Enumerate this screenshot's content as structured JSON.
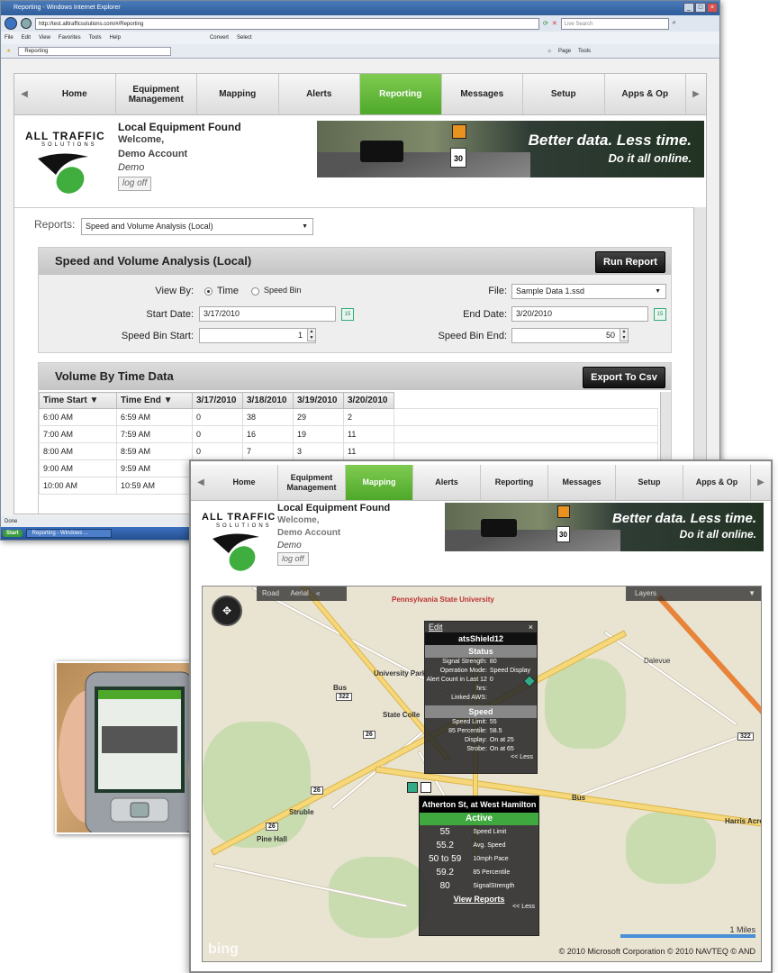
{
  "ie": {
    "title": "Reporting - Windows Internet Explorer",
    "url": "http://test.alltrafficsolutions.com/#/Reporting",
    "search_placeholder": "Live Search",
    "menu": [
      "File",
      "Edit",
      "View",
      "Favorites",
      "Tools",
      "Help"
    ],
    "convert": "Convert",
    "select": "Select",
    "fav_tab": "Reporting",
    "right_tools": [
      "Page",
      "Tools"
    ],
    "status": "Done",
    "start": "Start",
    "task": "Reporting - Windows ..."
  },
  "app": {
    "nav": [
      "Home",
      "Equipment Management",
      "Mapping",
      "Alerts",
      "Reporting",
      "Messages",
      "Setup",
      "Apps & Op"
    ],
    "nav_active_reporting": "Reporting",
    "nav_active_mapping": "Mapping",
    "brand": "ALL TRAFFIC",
    "brand_sub": "SOLUTIONS",
    "header_title": "Local Equipment Found",
    "welcome": "Welcome,",
    "account": "Demo Account",
    "user": "Demo",
    "logoff": "log off",
    "banner_tag1": "Better data. Less time.",
    "banner_tag2": "Do it all online.",
    "speed_sign": "30"
  },
  "reporting": {
    "reports_label": "Reports:",
    "report_select": "Speed and Volume Analysis (Local)",
    "panel_title": "Speed and Volume Analysis (Local)",
    "run_report": "Run Report",
    "view_by_label": "View By:",
    "view_time": "Time",
    "view_speed_bin": "Speed Bin",
    "file_label": "File:",
    "file_value": "Sample Data 1.ssd",
    "start_date_label": "Start Date:",
    "start_date": "3/17/2010",
    "end_date_label": "End Date:",
    "end_date": "3/20/2010",
    "speed_bin_start_label": "Speed Bin Start:",
    "speed_bin_start": "1",
    "speed_bin_end_label": "Speed Bin End:",
    "speed_bin_end": "50",
    "cal_icon_text": "15",
    "volume_title": "Volume By Time Data",
    "export_csv": "Export To Csv",
    "columns": [
      "Time Start",
      "Time End",
      "3/17/2010",
      "3/18/2010",
      "3/19/2010",
      "3/20/2010"
    ],
    "rows": [
      [
        "6:00 AM",
        "6:59 AM",
        "0",
        "38",
        "29",
        "2"
      ],
      [
        "7:00 AM",
        "7:59 AM",
        "0",
        "16",
        "19",
        "11"
      ],
      [
        "8:00 AM",
        "8:59 AM",
        "0",
        "7",
        "3",
        "11"
      ],
      [
        "9:00 AM",
        "9:59 AM",
        "",
        "",
        "",
        ""
      ],
      [
        "10:00 AM",
        "10:59 AM",
        "",
        "",
        "",
        ""
      ]
    ]
  },
  "map": {
    "toolbar_road": "Road",
    "toolbar_aerial": "Aerial",
    "layers": "Layers",
    "labels": {
      "psu": "Pennsylvania State University",
      "university_park": "University Park",
      "state_college": "State Colle",
      "strubble": "Struble",
      "pine_hall": "Pine Hall",
      "dalevue": "Dalevue",
      "harris_acre": "Harris Acre",
      "bus": "Bus",
      "scale": "1 Miles",
      "copyright": "© 2010 Microsoft Corporation   © 2010 NAVTEQ   © AND",
      "bing": "bing"
    },
    "shields": [
      "322",
      "26",
      "26",
      "26",
      "322",
      "26",
      "322"
    ],
    "popup1": {
      "edit": "Edit",
      "close": "×",
      "title": "atsShield12",
      "status_label": "Status",
      "status_rows": [
        [
          "Signal Strength:",
          "80"
        ],
        [
          "Operation Mode:",
          "Speed Display"
        ],
        [
          "Alert Count in Last 12 hrs:",
          "0"
        ],
        [
          "Linked AWS:",
          ""
        ]
      ],
      "speed_label": "Speed",
      "speed_rows": [
        [
          "Speed Limit:",
          "55"
        ],
        [
          "85 Percentile:",
          "58.5"
        ],
        [
          "Display:",
          "On at 25"
        ],
        [
          "Strobe:",
          "On at 65"
        ]
      ],
      "less": "<< Less"
    },
    "popup2": {
      "title": "Atherton St, at West Hamilton",
      "status": "Active",
      "rows": [
        [
          "55",
          "Speed Limit"
        ],
        [
          "55.2",
          "Avg. Speed"
        ],
        [
          "50 to 59",
          "10mph Pace"
        ],
        [
          "59.2",
          "85 Percentile"
        ],
        [
          "80",
          "SignalStrength"
        ]
      ],
      "view_reports": "View Reports",
      "less": "<< Less"
    }
  }
}
